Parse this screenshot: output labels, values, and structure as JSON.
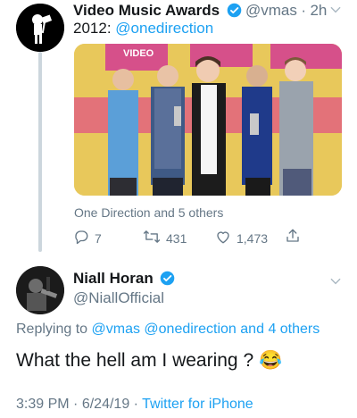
{
  "tweet1": {
    "name": "Video Music Awards",
    "handle": "@vmas",
    "separator": "·",
    "time": "2h",
    "text_prefix": "2012:",
    "mention": "@onedirection",
    "media_banner": "VIDEO",
    "tag_line": "One Direction and 5 others",
    "reply_count": "7",
    "retweet_count": "431",
    "like_count": "1,473",
    "colors": {
      "verified": "#1da1f2",
      "link": "#1da1f2",
      "secondary": "#657786"
    },
    "icons": [
      "verified-badge-icon",
      "chevron-down-icon",
      "reply-icon",
      "retweet-icon",
      "like-icon",
      "share-icon"
    ]
  },
  "tweet2": {
    "name": "Niall Horan",
    "handle": "@NiallOfficial",
    "replying_prefix": "Replying to",
    "replying_users": "@vmas @onedirection",
    "replying_and": "and",
    "replying_others": "4 others",
    "text": "What the hell am I wearing ?",
    "emoji": "😂",
    "time": "3:39 PM",
    "dot": "·",
    "date": "6/24/19",
    "source": "Twitter for iPhone"
  }
}
